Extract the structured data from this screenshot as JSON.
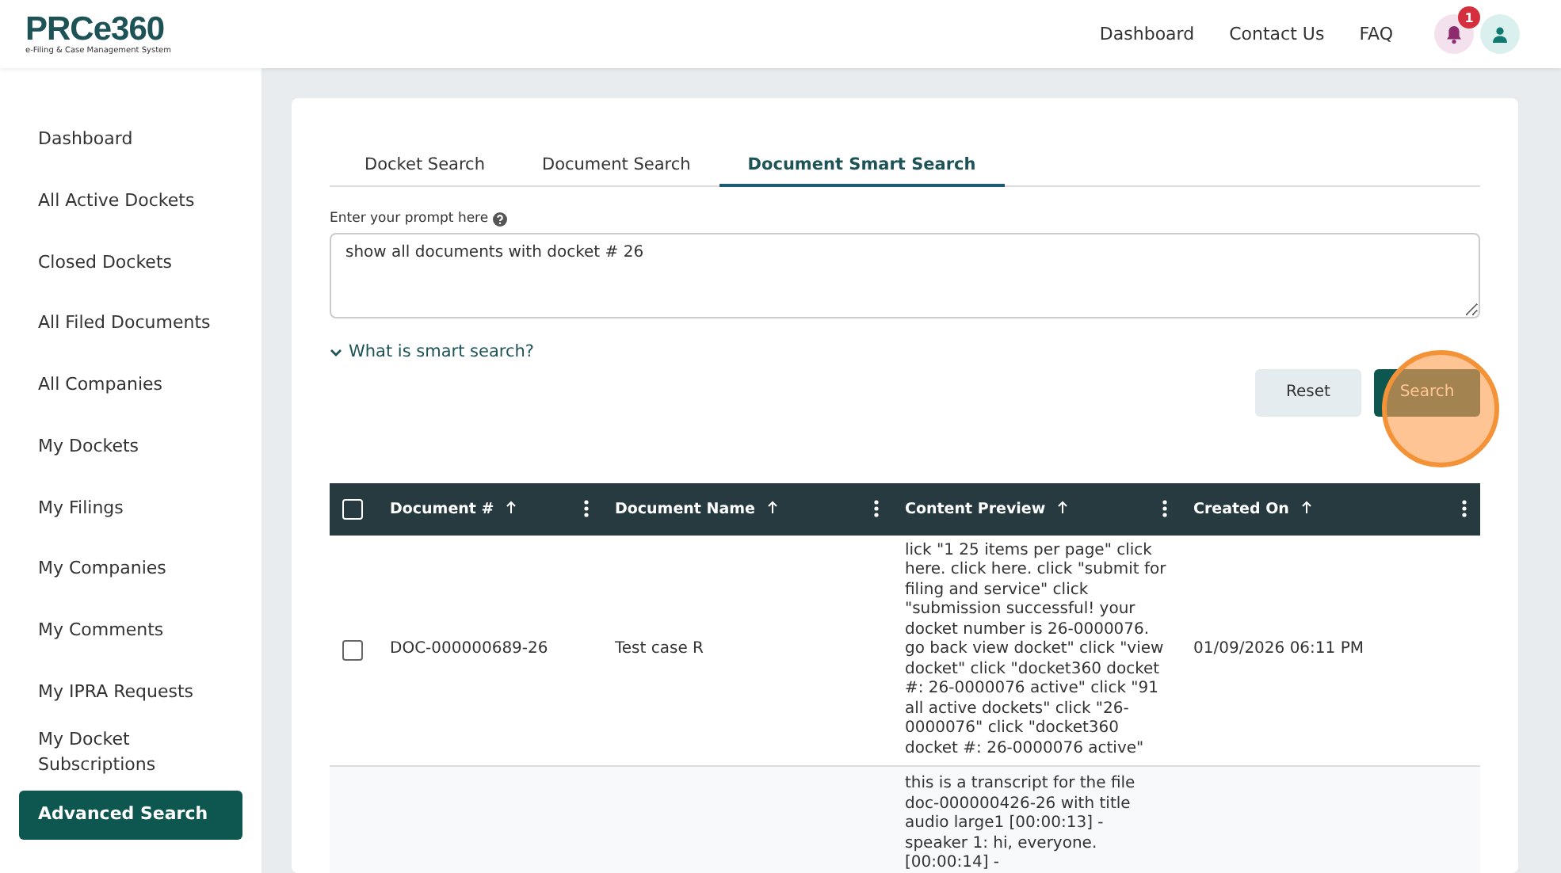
{
  "header": {
    "logo": "PRCe360",
    "tagline": "e-Filing & Case Management System",
    "nav": [
      "Dashboard",
      "Contact Us",
      "FAQ"
    ],
    "notification_count": "1"
  },
  "sidebar": {
    "items": [
      {
        "label": "Dashboard",
        "selected": false
      },
      {
        "label": "All Active Dockets",
        "selected": false
      },
      {
        "label": "Closed Dockets",
        "selected": false
      },
      {
        "label": "All Filed Documents",
        "selected": false
      },
      {
        "label": "All Companies",
        "selected": false
      },
      {
        "label": "My Dockets",
        "selected": false
      },
      {
        "label": "My Filings",
        "selected": false
      },
      {
        "label": "My Companies",
        "selected": false
      },
      {
        "label": "My Comments",
        "selected": false
      },
      {
        "label": "My IPRA Requests",
        "selected": false
      },
      {
        "label": "My Docket Subscriptions",
        "selected": false
      },
      {
        "label": "Advanced Search",
        "selected": true
      }
    ]
  },
  "tabs": [
    {
      "label": "Docket Search",
      "selected": false
    },
    {
      "label": "Document Search",
      "selected": false
    },
    {
      "label": "Document Smart Search",
      "selected": true
    }
  ],
  "prompt": {
    "label": "Enter your prompt here",
    "value": "show all documents with docket # 26"
  },
  "help_link": "What is smart search?",
  "buttons": {
    "reset": "Reset",
    "search": "Search"
  },
  "click_marker": true,
  "table": {
    "select_all_checked": false,
    "columns": [
      "Document #",
      "Document Name",
      "Content Preview",
      "Created On"
    ],
    "rows": [
      {
        "checked": false,
        "cells": [
          "DOC-000000689-26",
          "Test case R",
          "lick \"1 25 items per page\" click here. click here. click \"submit for filing and service\" click \"submission successful! your docket number is 26-0000076. go back view docket\" click \"view docket\" click \"docket360 docket #: 26-0000076 active\" click \"91 all active dockets\" click \"26-0000076\" click \"docket360 docket #: 26-0000076 active\"",
          "01/09/2026 06:11 PM"
        ]
      },
      {
        "cells": [
          "",
          "",
          "this is a transcript for the file doc-000000426-26 with title audio large1 [00:00:13] - speaker 1: hi, everyone. [00:00:14] -",
          ""
        ]
      }
    ]
  }
}
